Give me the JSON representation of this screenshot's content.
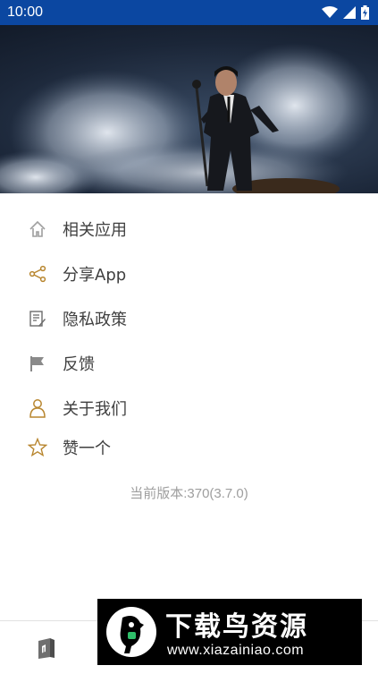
{
  "status_bar": {
    "time": "10:00",
    "icons": [
      "wifi-icon",
      "signal-icon",
      "battery-icon"
    ],
    "color": "#0b47a1"
  },
  "menu": {
    "items": [
      {
        "label": "相关应用",
        "icon": "house-icon",
        "icon_color": "#9e9e9e"
      },
      {
        "label": "分享App",
        "icon": "share-icon",
        "icon_color": "#b8862f"
      },
      {
        "label": "隐私政策",
        "icon": "document-icon",
        "icon_color": "#6b6b6b"
      },
      {
        "label": "反馈",
        "icon": "flag-icon",
        "icon_color": "#6b6b6b"
      },
      {
        "label": "关于我们",
        "icon": "person-icon",
        "icon_color": "#b8862f"
      },
      {
        "label": "赞一个",
        "icon": "star-icon",
        "icon_color": "#b8862f"
      }
    ]
  },
  "version_text": "当前版本:370(3.7.0)",
  "watermark": {
    "title": "下载鸟资源",
    "url": "www.xiazainiao.com"
  }
}
